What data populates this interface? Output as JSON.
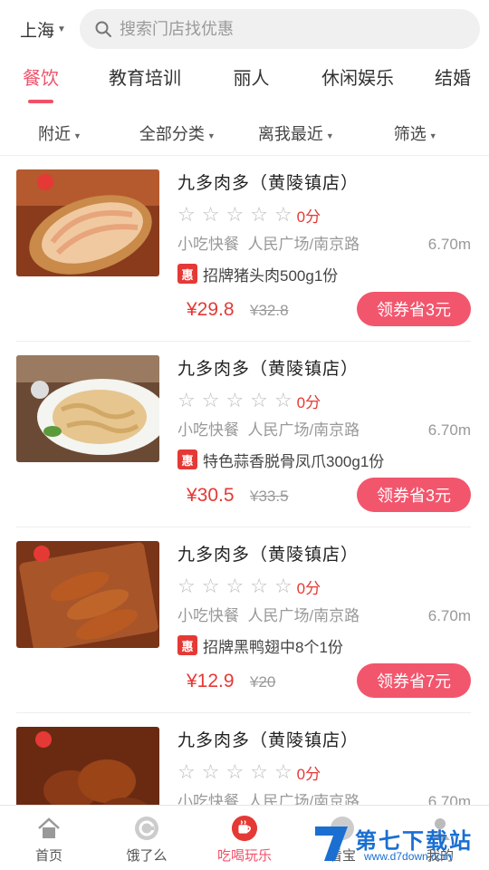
{
  "header": {
    "city": "上海",
    "search_placeholder": "搜索门店找优惠"
  },
  "categories": [
    "餐饮",
    "教育培训",
    "丽人",
    "休闲娱乐",
    "结婚"
  ],
  "filters": [
    "附近",
    "全部分类",
    "离我最近",
    "筛选"
  ],
  "deal_tag": "惠",
  "items": [
    {
      "name": "九多肉多（黄陵镇店）",
      "score": "0分",
      "category": "小吃快餐",
      "area": "人民广场/南京路",
      "distance": "6.70m",
      "deal": "招牌猪头肉500g1份",
      "price": "¥29.8",
      "original_price": "¥32.8",
      "coupon": "领券省3元"
    },
    {
      "name": "九多肉多（黄陵镇店）",
      "score": "0分",
      "category": "小吃快餐",
      "area": "人民广场/南京路",
      "distance": "6.70m",
      "deal": "特色蒜香脱骨凤爪300g1份",
      "price": "¥30.5",
      "original_price": "¥33.5",
      "coupon": "领券省3元"
    },
    {
      "name": "九多肉多（黄陵镇店）",
      "score": "0分",
      "category": "小吃快餐",
      "area": "人民广场/南京路",
      "distance": "6.70m",
      "deal": "招牌黑鸭翅中8个1份",
      "price": "¥12.9",
      "original_price": "¥20",
      "coupon": "领券省7元"
    },
    {
      "name": "九多肉多（黄陵镇店）",
      "score": "0分",
      "category": "小吃快餐",
      "area": "人民广场/南京路",
      "distance": "6.70m"
    }
  ],
  "tabbar": [
    "首页",
    "饿了么",
    "吃喝玩乐",
    "看宝",
    "我的"
  ],
  "active_tab": "吃喝玩乐",
  "watermark": {
    "main": "第七下载站",
    "sub": "www.d7down.com"
  },
  "colors": {
    "accent": "#f0526a",
    "price": "#e53935",
    "watermark": "#1a6fd1"
  },
  "icons": [
    "chevron-down-icon",
    "search-icon",
    "star-icon",
    "home-icon",
    "eleme-icon",
    "coffee-cup-icon",
    "user-icon"
  ]
}
